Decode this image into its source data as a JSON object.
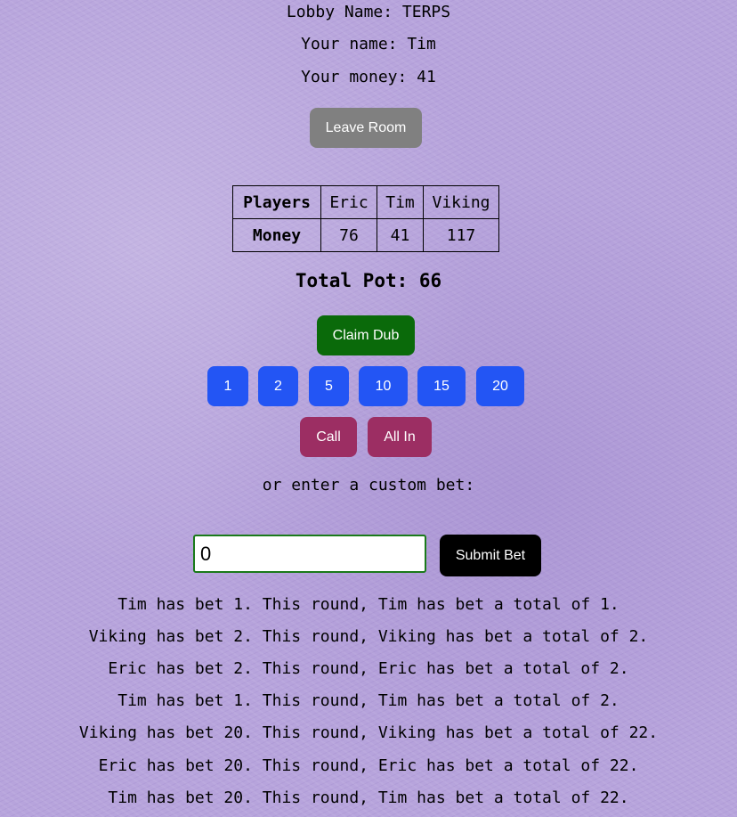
{
  "lobby": {
    "lobby_line": "Lobby Name: TERPS",
    "name_line": "Your name: Tim",
    "money_line": "Your money: 41"
  },
  "leave_button": "Leave Room",
  "table": {
    "headers": [
      "Players",
      "Eric",
      "Tim",
      "Viking"
    ],
    "row_label": "Money",
    "values": [
      "76",
      "41",
      "117"
    ]
  },
  "pot": "Total Pot: 66",
  "claim_button": "Claim Dub",
  "bet_buttons": [
    "1",
    "2",
    "5",
    "10",
    "15",
    "20"
  ],
  "action_buttons": [
    "Call",
    "All In"
  ],
  "custom_prompt": "or enter a custom bet:",
  "custom_input": {
    "value": "0"
  },
  "submit_button": "Submit Bet",
  "log": [
    "Tim has bet 1. This round, Tim has bet a total of 1.",
    "Viking has bet 2. This round, Viking has bet a total of 2.",
    "Eric has bet 2. This round, Eric has bet a total of 2.",
    "Tim has bet 1. This round, Tim has bet a total of 2.",
    "Viking has bet 20. This round, Viking has bet a total of 22.",
    "Eric has bet 20. This round, Eric has bet a total of 22.",
    "Tim has bet 20. This round, Tim has bet a total of 22."
  ],
  "colors": {
    "background": "#b7a4dc",
    "leave": "#808080",
    "claim": "#0a6a0a",
    "bet": "#2355f4",
    "action": "#9c2e63",
    "submit": "#000000"
  }
}
